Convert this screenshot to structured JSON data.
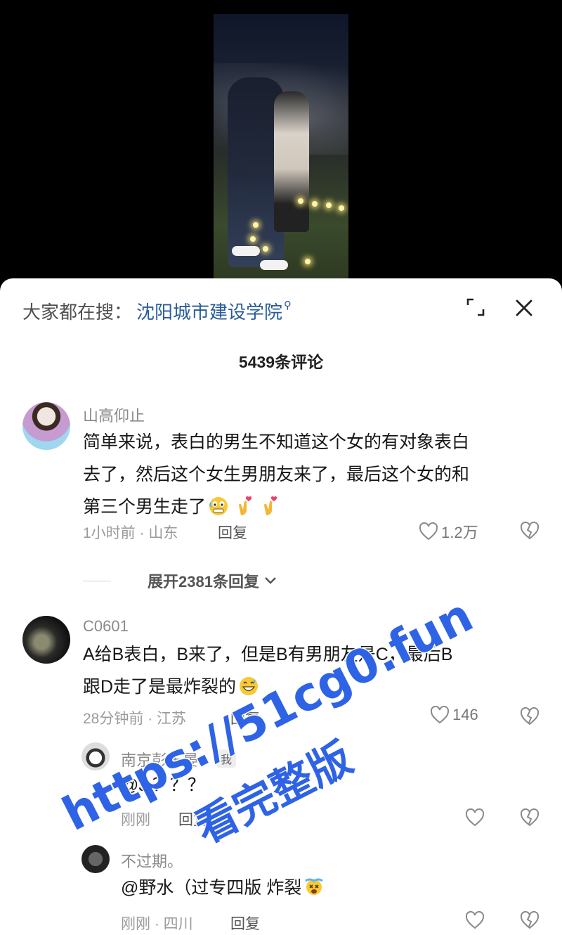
{
  "search": {
    "prefix": "大家都在搜：",
    "link": "沈阳城市建设学院",
    "icon": "search-icon"
  },
  "header": {
    "comment_count": "5439条评论"
  },
  "comments": [
    {
      "username": "山高仰止",
      "text_lines": [
        "简单来说，表白的男生不知道这个女的有对象表白",
        "去了，然后这个女生男朋友来了，最后这个女的和",
        "第三个男生走了"
      ],
      "emojis": [
        "grimacing-face-emoji",
        "heart-hands-emoji",
        "heart-hands-emoji"
      ],
      "time_location": "1小时前 · 山东",
      "reply": "回复",
      "likes": "1.2万",
      "expand": "展开2381条回复"
    },
    {
      "username": "C0601",
      "text_lines": [
        "A给B表白，B来了，但是B有男朋友是C，最后B",
        "跟D走了是最炸裂的"
      ],
      "emojis": [
        "grinning-sweat-emoji"
      ],
      "time_location": "28分钟前 · 江苏",
      "reply": "回复",
      "likes": "146"
    }
  ],
  "replies": [
    {
      "username": "南京彭于晏",
      "badge": "我",
      "text": "@J.？？？",
      "time_location": "刚刚",
      "reply": "回复"
    },
    {
      "username": "不过期。",
      "text": "@野水（过专四版 炸裂",
      "emojis": [
        "dizzy-face-emoji"
      ],
      "time_location": "刚刚 · 四川",
      "reply": "回复"
    }
  ],
  "watermark": {
    "url": "https://51cg0.fun",
    "text": "看完整版"
  },
  "colors": {
    "link_blue": "#2a5b9b",
    "watermark_blue": "#2f63e6",
    "meta_gray": "#9a9a9a"
  }
}
